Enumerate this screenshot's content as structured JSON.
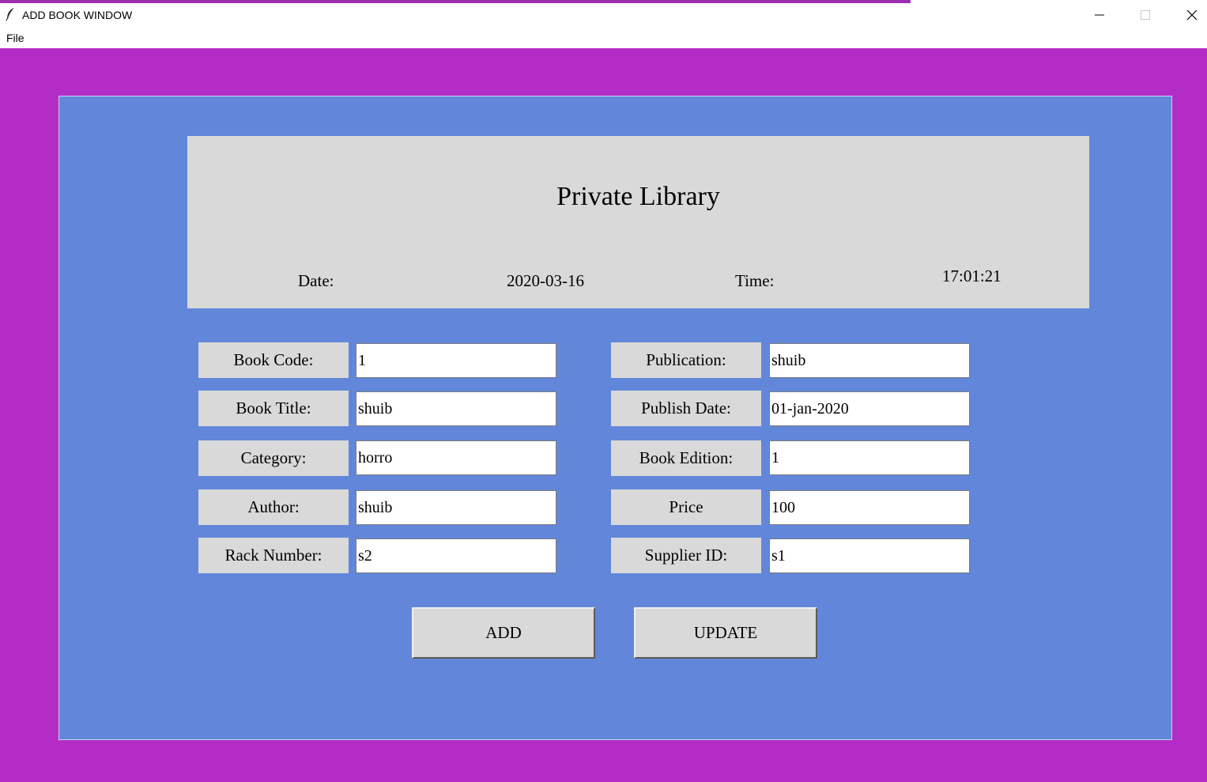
{
  "window": {
    "title": "ADD BOOK WINDOW",
    "app_icon": "feather-icon",
    "controls": [
      "minimize-icon",
      "maximize-icon",
      "close-icon"
    ]
  },
  "menu": {
    "file": "File"
  },
  "colors": {
    "window_background": "#b42cc6",
    "panel_background": "#6287da",
    "header_background": "#d9d9d9"
  },
  "header": {
    "title": "Private Library",
    "date_label": "Date:",
    "date_value": "2020-03-16",
    "time_label": "Time:",
    "time_value": "17:01:21"
  },
  "fields": {
    "book_code": {
      "label": "Book Code:",
      "value": "1"
    },
    "book_title": {
      "label": "Book Title:",
      "value": "shuib"
    },
    "category": {
      "label": "Category:",
      "value": "horro"
    },
    "author": {
      "label": "Author:",
      "value": "shuib"
    },
    "rack_number": {
      "label": "Rack Number:",
      "value": "s2"
    },
    "publication": {
      "label": "Publication:",
      "value": "shuib"
    },
    "publish_date": {
      "label": "Publish Date:",
      "value": "01-jan-2020"
    },
    "book_edition": {
      "label": "Book Edition:",
      "value": "1"
    },
    "price": {
      "label": "Price",
      "value": "100"
    },
    "supplier_id": {
      "label": "Supplier ID:",
      "value": "s1"
    }
  },
  "buttons": {
    "add": "ADD",
    "update": "UPDATE"
  }
}
